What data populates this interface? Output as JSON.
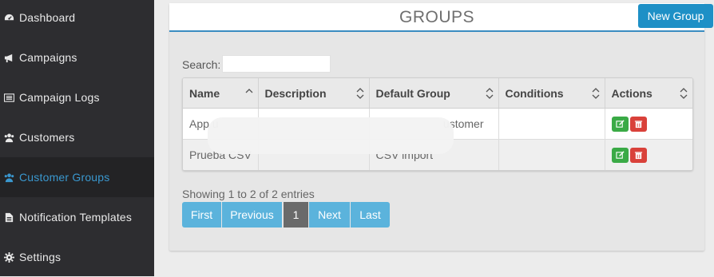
{
  "sidebar": {
    "items": [
      {
        "label": "Dashboard",
        "icon": "dashboard-icon"
      },
      {
        "label": "Campaigns",
        "icon": "bullhorn-icon"
      },
      {
        "label": "Campaign Logs",
        "icon": "list-icon"
      },
      {
        "label": "Customers",
        "icon": "users-icon"
      },
      {
        "label": "Customer Groups",
        "icon": "users-icon",
        "active": true
      },
      {
        "label": "Notification Templates",
        "icon": "file-icon"
      },
      {
        "label": "Settings",
        "icon": "gear-icon"
      }
    ]
  },
  "panel": {
    "title": "GROUPS",
    "new_group_label": "New Group"
  },
  "search": {
    "label": "Search:",
    "value": ""
  },
  "table": {
    "columns": [
      "Name",
      "Description",
      "Default Group",
      "Conditions",
      "Actions"
    ],
    "rows": [
      {
        "name": "App u",
        "description": "",
        "default_group": "ustomer",
        "conditions": ""
      },
      {
        "name": "Prueba CSV",
        "description": "",
        "default_group": "CSV import",
        "conditions": ""
      }
    ]
  },
  "footer": {
    "info": "Showing 1 to 2 of 2 entries",
    "pagination": {
      "first": "First",
      "previous": "Previous",
      "current": "1",
      "next": "Next",
      "last": "Last"
    }
  },
  "colors": {
    "sidebar_bg": "#2d2d30",
    "active_text": "#3a98cf",
    "primary": "#1e90c6",
    "pager": "#5bb3dc",
    "edit": "#3aaa46",
    "delete": "#d9413a"
  }
}
